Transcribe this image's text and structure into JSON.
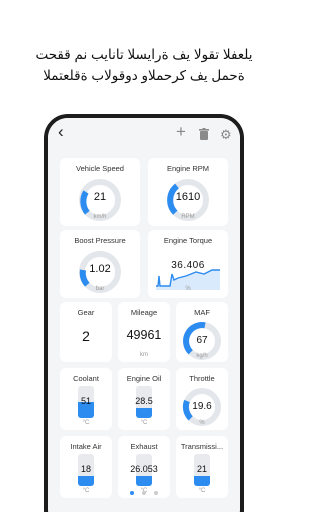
{
  "headline": {
    "line1": "يلعفلا تقولا يف ةرايسلا تانايب نم ققحت",
    "line2": "ةحمل يف كرحملاو دوقولاب ةقلعتملا"
  },
  "colors": {
    "accent": "#2d8cf0",
    "track": "#e3e6ea"
  },
  "toolbar": {
    "back_icon": "chevron-left-icon",
    "add_icon": "plus-icon",
    "delete_icon": "trash-icon",
    "settings_icon": "gear-icon"
  },
  "gauges": {
    "speed": {
      "title": "Vehicle Speed",
      "value": "21",
      "unit": "km/h"
    },
    "rpm": {
      "title": "Engine RPM",
      "value": "1610",
      "unit": "RPM"
    },
    "boost": {
      "title": "Boost Pressure",
      "value": "1.02",
      "unit": "bar"
    },
    "torque": {
      "title": "Engine Torque",
      "value": "36.406",
      "unit": "%"
    }
  },
  "numbers": {
    "gear": {
      "title": "Gear",
      "value": "2",
      "unit": ""
    },
    "mileage": {
      "title": "Mileage",
      "value": "49961",
      "unit": "km"
    },
    "maf": {
      "title": "MAF",
      "value": "67",
      "unit": "kg/h"
    }
  },
  "bars_row1": {
    "coolant": {
      "title": "Coolant",
      "value": "51",
      "unit": "°C"
    },
    "oil": {
      "title": "Engine Oil",
      "value": "28.5",
      "unit": "°C"
    },
    "throttle": {
      "title": "Throttle",
      "value": "19.6",
      "unit": "%"
    }
  },
  "bars_row2": {
    "intake": {
      "title": "Intake Air",
      "value": "18",
      "unit": "°C"
    },
    "exhaust": {
      "title": "Exhaust",
      "value": "26.053",
      "unit": "°C"
    },
    "trans": {
      "title": "Transmissi...",
      "value": "21",
      "unit": "°C"
    }
  },
  "pagination": {
    "pages": 3,
    "active": 1
  }
}
